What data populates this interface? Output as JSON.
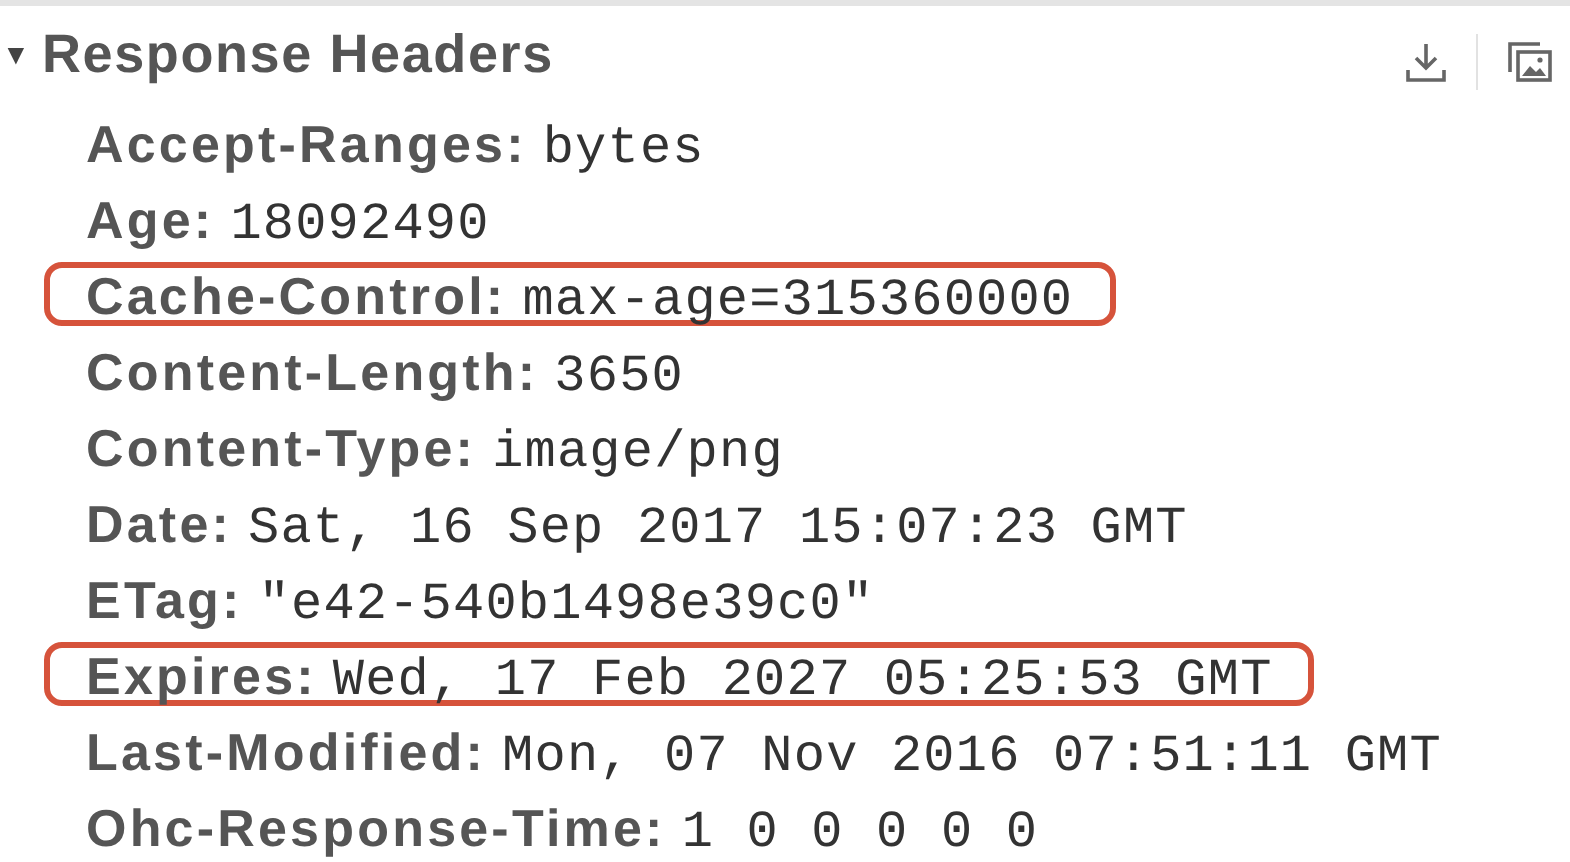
{
  "section": {
    "title": "Response Headers",
    "expanded": true,
    "toggle": "▼"
  },
  "headers": [
    {
      "name": "Accept-Ranges:",
      "value": "bytes",
      "highlighted": false
    },
    {
      "name": "Age:",
      "value": "18092490",
      "highlighted": false
    },
    {
      "name": "Cache-Control:",
      "value": "max-age=315360000",
      "highlighted": true
    },
    {
      "name": "Content-Length:",
      "value": "3650",
      "highlighted": false
    },
    {
      "name": "Content-Type:",
      "value": "image/png",
      "highlighted": false
    },
    {
      "name": "Date:",
      "value": "Sat, 16 Sep 2017 15:07:23 GMT",
      "highlighted": false
    },
    {
      "name": "ETag:",
      "value": "\"e42-540b1498e39c0\"",
      "highlighted": false
    },
    {
      "name": "Expires:",
      "value": "Wed, 17 Feb 2027 05:25:53 GMT",
      "highlighted": true
    },
    {
      "name": "Last-Modified:",
      "value": "Mon, 07 Nov 2016 07:51:11 GMT",
      "highlighted": false
    },
    {
      "name": "Ohc-Response-Time:",
      "value": "1 0 0 0 0 0",
      "highlighted": false
    }
  ]
}
